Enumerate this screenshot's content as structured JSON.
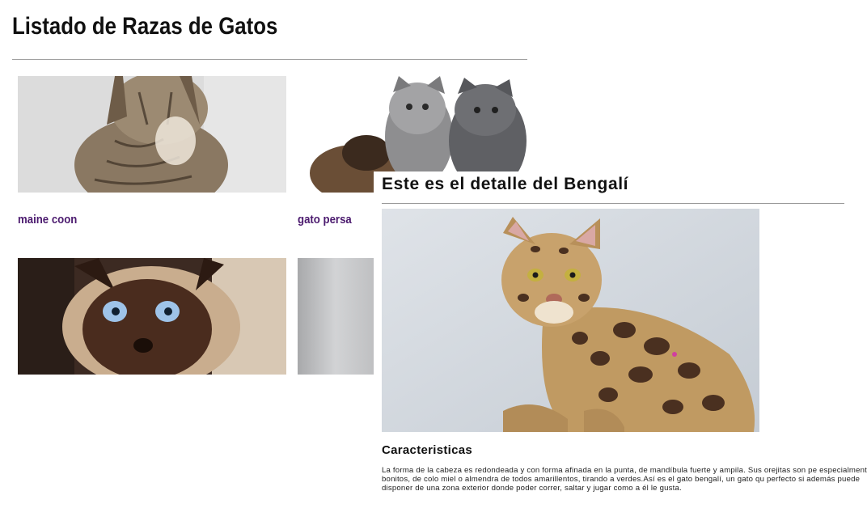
{
  "page": {
    "title": "Listado de Razas de Gatos"
  },
  "breeds": [
    {
      "name": "maine coon",
      "image": "maine-coon-photo"
    },
    {
      "name": "gato persa",
      "image": "persian-kittens-photo"
    },
    {
      "name": "",
      "image": "siamese-photo"
    },
    {
      "name": "",
      "image": "grey-blurred-photo"
    }
  ],
  "detail": {
    "title": "Este es el detalle del Bengalí",
    "image": "bengal-cat-photo",
    "section_title": "Caracteristicas",
    "description": "La forma de la cabeza es redondeada y con forma afinada en la punta, de mandíbula fuerte y ampila. Sus orejitas son pe especialmente bonitos, de colo miel o almendra de todos amarillentos, tirando a verdes.Así es el gato bengalí, un gato qu perfecto si además puede disponer de una zona exterior donde poder correr, saltar y jugar como a él le gusta."
  },
  "colors": {
    "link": "#4b1a6e",
    "rule": "#a0a0a0",
    "text": "#111111"
  }
}
